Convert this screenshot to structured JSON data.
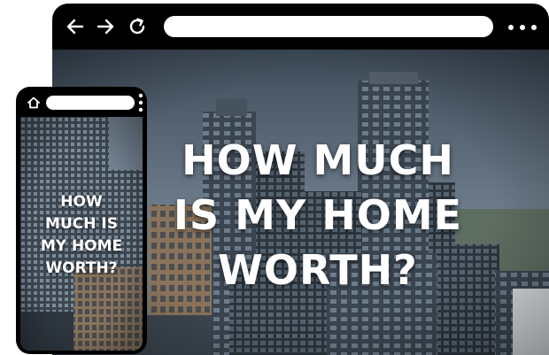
{
  "desktop": {
    "toolbar": {
      "back_icon": "arrow-left-icon",
      "forward_icon": "arrow-right-icon",
      "reload_icon": "reload-icon",
      "more_icon": "more-horizontal-icon",
      "address_value": ""
    },
    "hero": {
      "headline_lines": [
        "HOW MUCH",
        "IS MY HOME",
        "WORTH?"
      ]
    }
  },
  "phone": {
    "toolbar": {
      "home_icon": "home-icon",
      "more_icon": "more-vertical-icon",
      "address_value": ""
    },
    "hero": {
      "headline_lines": [
        "HOW",
        "MUCH IS",
        "MY HOME",
        "WORTH?"
      ]
    }
  },
  "colors": {
    "frame": "#000000",
    "address_bar": "#ffffff",
    "headline_text": "#ffffff",
    "sky": "#5a6a7a"
  }
}
